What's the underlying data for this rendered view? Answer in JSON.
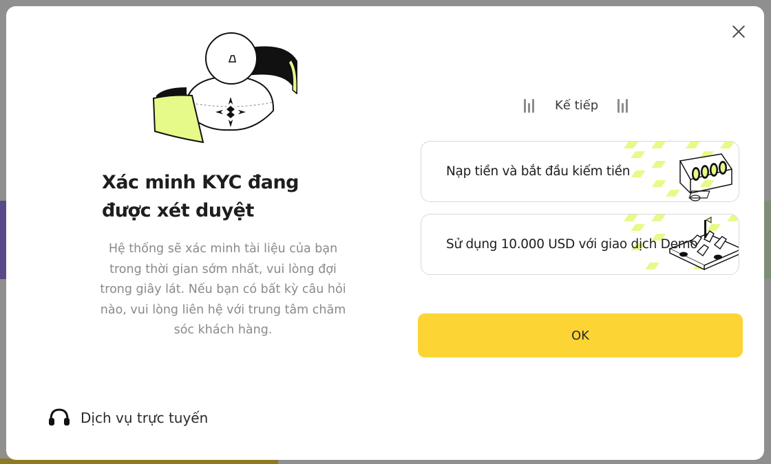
{
  "modal": {
    "title": "Xác minh KYC đang được xét duyệt",
    "description": "Hệ thống sẽ xác minh tài liệu của bạn trong thời gian sớm nhất, vui lòng đợi trong giây lát. Nếu bạn có bất kỳ câu hỏi nào, vui lòng liên hệ với trung tâm chăm sóc khách hàng.",
    "support_label": "Dịch vụ trực tuyến",
    "next_label": "Kế tiếp",
    "cards": [
      {
        "label": "Nạp tiền và bắt đầu kiếm tiền"
      },
      {
        "label": "Sử dụng 10.000 USD với giao dịch Demo"
      }
    ],
    "ok_label": "OK"
  },
  "colors": {
    "accent_yellow": "#fcd535",
    "lime": "#e6fa8a",
    "overlay": "#8f8f8f"
  },
  "icons": [
    "close-icon",
    "headset-icon",
    "kyc-user-illustration",
    "coin-display-illustration",
    "trading-board-illustration"
  ]
}
